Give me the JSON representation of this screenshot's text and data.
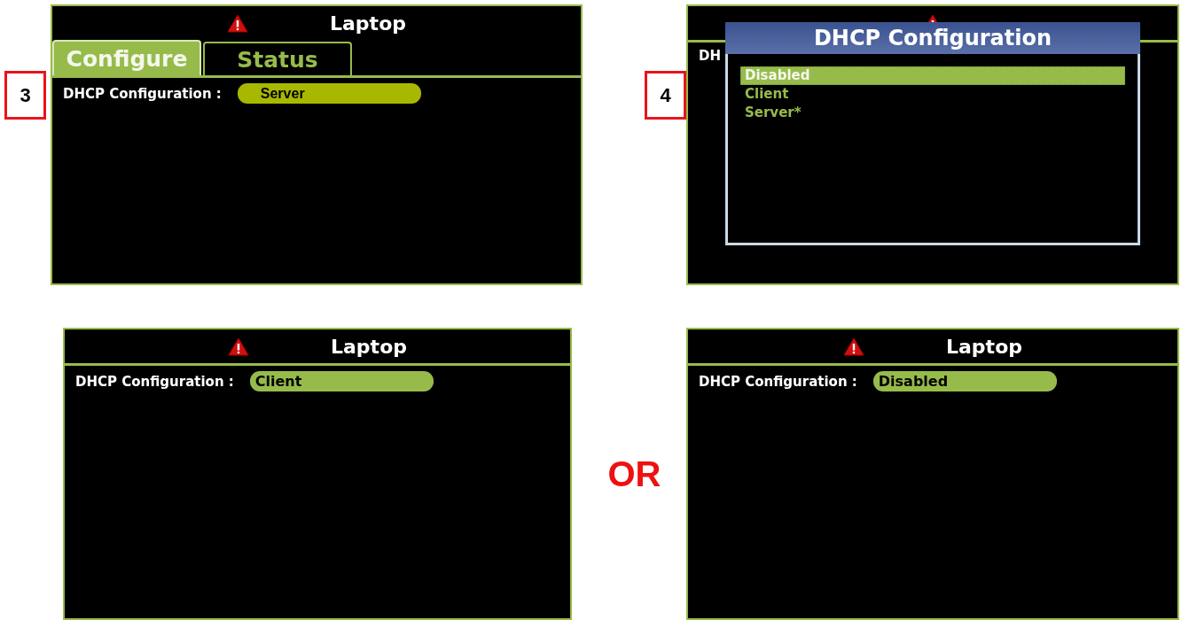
{
  "panels": [
    {
      "kind": "screen",
      "step": "3",
      "title": "Laptop",
      "tabs": [
        {
          "label": "Configure",
          "selected": true
        },
        {
          "label": "Status",
          "selected": false
        }
      ],
      "field": {
        "label": "DHCP Configuration :",
        "value": "Server",
        "kind": "plain"
      }
    },
    {
      "kind": "dialog_screen",
      "step": "4",
      "behind_label": "DH",
      "dialog": {
        "title": "DHCP Configuration",
        "options": [
          {
            "label": "Disabled",
            "selected": true
          },
          {
            "label": "Client",
            "selected": false
          },
          {
            "label": "Server*",
            "selected": false
          }
        ]
      }
    },
    {
      "kind": "screen",
      "title": "Laptop",
      "field": {
        "label": "DHCP Configuration :",
        "value": "Client",
        "kind": "bold"
      }
    },
    {
      "kind": "screen",
      "title": "Laptop",
      "field": {
        "label": "DHCP Configuration :",
        "value": "Disabled",
        "kind": "bold"
      }
    }
  ],
  "separator": "OR"
}
